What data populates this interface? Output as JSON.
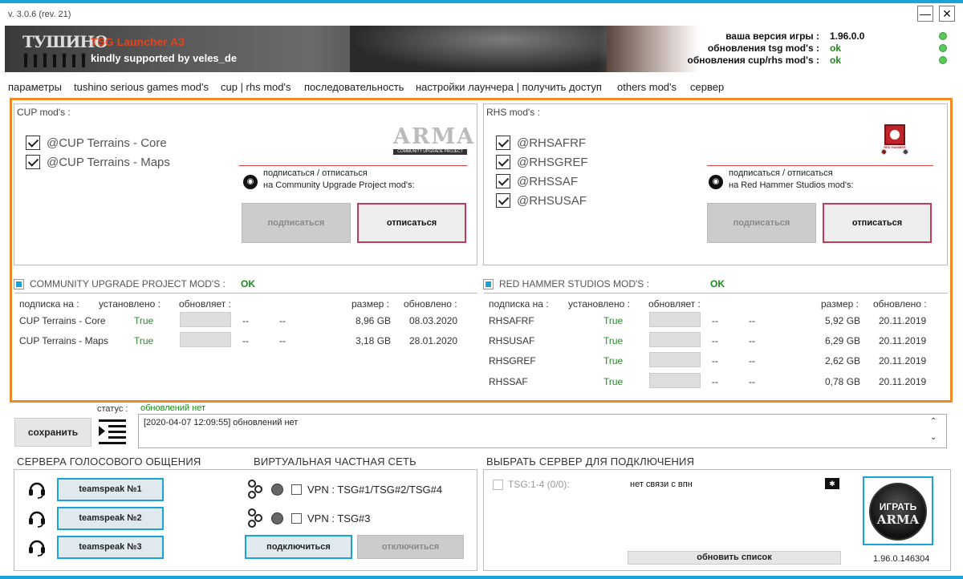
{
  "app": {
    "version": "v. 3.0.6 (rev. 21)"
  },
  "window": {
    "minimize": "—",
    "close": "✕"
  },
  "banner": {
    "logo": "ТУШИНО",
    "title": "TSG Launcher A3",
    "subtitle": "kindly supported by veles_de",
    "rows": [
      {
        "label": "ваша версия игры :",
        "value": "1.96.0.0",
        "value_color": "#111"
      },
      {
        "label": "обновления tsg mod's :",
        "value": "ok",
        "value_color": "#1a8a1a"
      },
      {
        "label": "обновления cup/rhs mod's :",
        "value": "ok",
        "value_color": "#1a8a1a"
      }
    ]
  },
  "menu": [
    "параметры",
    "tushino serious games mod's",
    "cup | rhs mod's",
    "последовательность",
    "настройки лаунчера | получить доступ",
    "others mod's",
    "сервер"
  ],
  "cup": {
    "title": "CUP mod's :",
    "logo_text": "ARMA",
    "logo_sub": "COMMUNITY UPGRADE PROJECT",
    "mods": [
      "@CUP Terrains - Core",
      "@CUP Terrains - Maps"
    ],
    "sub_line1": "подписаться / отписаться",
    "sub_line2": "на Community Upgrade Project mod's:",
    "subscribe": "подписаться",
    "unsubscribe": "отписаться",
    "section": "COMMUNITY UPGRADE PROJECT MOD'S :",
    "status": "OK",
    "headers": {
      "sub": "подписка на :",
      "inst": "установлено :",
      "upd": "обновляет :",
      "size": "размер :",
      "updated": "обновлено :"
    },
    "rows": [
      {
        "name": "CUP Terrains - Core",
        "inst": "True",
        "d1": "--",
        "d2": "--",
        "size": "8,96 GB",
        "date": "08.03.2020"
      },
      {
        "name": "CUP Terrains - Maps",
        "inst": "True",
        "d1": "--",
        "d2": "--",
        "size": "3,18 GB",
        "date": "28.01.2020"
      }
    ]
  },
  "rhs": {
    "title": "RHS mod's :",
    "logo_text": "RED HAMMER",
    "mods": [
      "@RHSAFRF",
      "@RHSGREF",
      "@RHSSAF",
      "@RHSUSAF"
    ],
    "sub_line1": "подписаться / отписаться",
    "sub_line2": "на Red Hammer Studios mod's:",
    "subscribe": "подписаться",
    "unsubscribe": "отписаться",
    "section": "RED HAMMER STUDIOS MOD'S :",
    "status": "OK",
    "headers": {
      "sub": "подписка на :",
      "inst": "установлено :",
      "upd": "обновляет :",
      "size": "размер :",
      "updated": "обновлено :"
    },
    "rows": [
      {
        "name": "RHSAFRF",
        "inst": "True",
        "d1": "--",
        "d2": "--",
        "size": "5,92 GB",
        "date": "20.11.2019"
      },
      {
        "name": "RHSUSAF",
        "inst": "True",
        "d1": "--",
        "d2": "--",
        "size": "6,29 GB",
        "date": "20.11.2019"
      },
      {
        "name": "RHSGREF",
        "inst": "True",
        "d1": "--",
        "d2": "--",
        "size": "2,62 GB",
        "date": "20.11.2019"
      },
      {
        "name": "RHSSAF",
        "inst": "True",
        "d1": "--",
        "d2": "--",
        "size": "0,78 GB",
        "date": "20.11.2019"
      }
    ]
  },
  "bottom": {
    "save": "сохранить",
    "status_label": "статус :",
    "status_value": "обновлений нет",
    "log": "[2020-04-07 12:09:55] обновлений нет",
    "voice_title": "СЕРВЕРА ГОЛОСОВОГО ОБЩЕНИЯ",
    "teamspeak": [
      "teamspeak №1",
      "teamspeak №2",
      "teamspeak №3"
    ],
    "vpn_title": "ВИРТУАЛЬНАЯ ЧАСТНАЯ СЕТЬ",
    "vpn": [
      "VPN : TSG#1/TSG#2/TSG#4",
      "VPN : TSG#3"
    ],
    "connect": "подключиться",
    "disconnect": "отключиться",
    "server_title": "ВЫБРАТЬ СЕРВЕР ДЛЯ ПОДКЛЮЧЕНИЯ",
    "server_name": "TSG:1-4 (0/0):",
    "server_status": "нет связи с впн",
    "refresh": "обновить список",
    "play": "ИГРАТЬ",
    "play_sub": "ARMA",
    "game_version": "1.96.0.146304"
  }
}
